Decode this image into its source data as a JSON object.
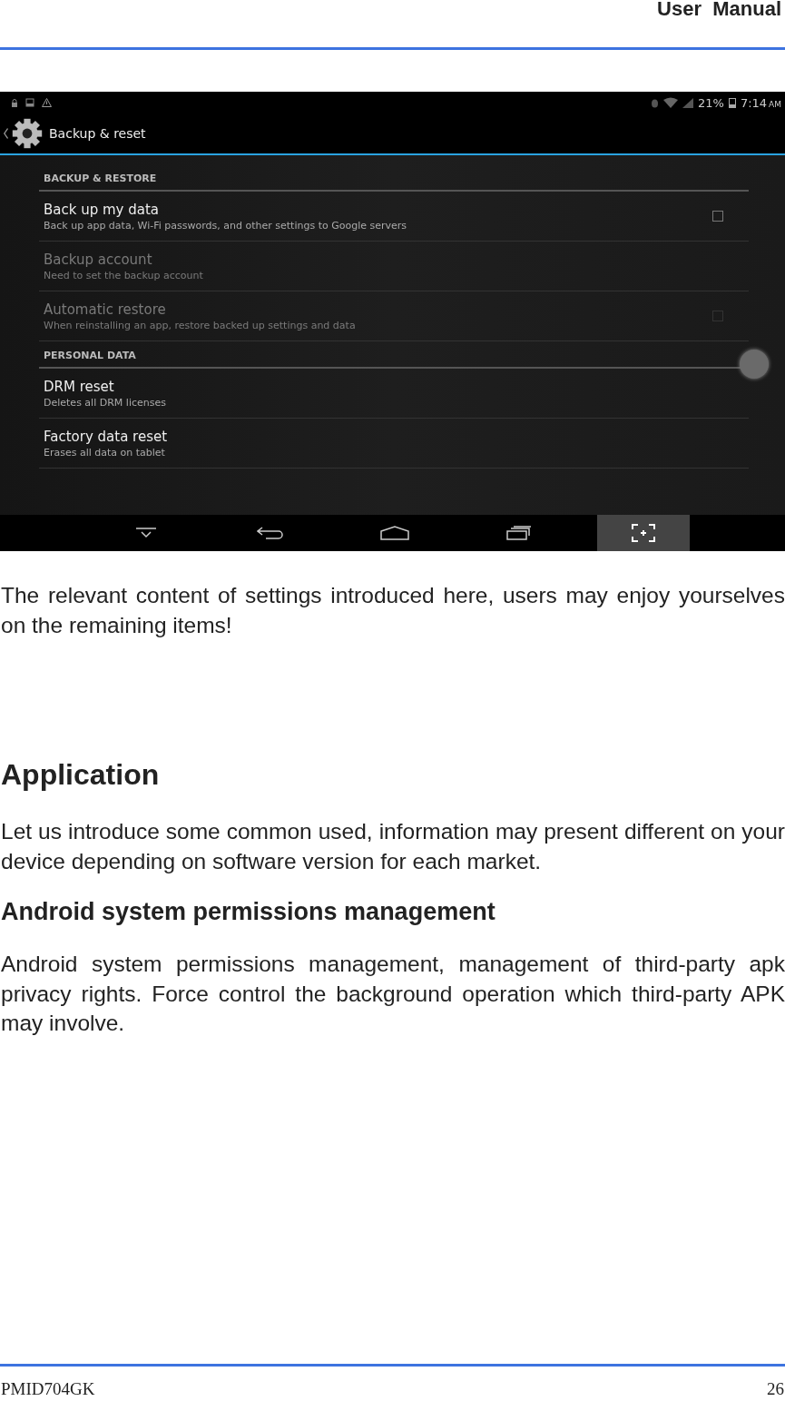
{
  "header": {
    "title": "User  Manual"
  },
  "screenshot": {
    "status_bar": {
      "battery": "21%",
      "time": "7:14",
      "meridiem": "AM"
    },
    "action_bar": {
      "title": "Backup & reset"
    },
    "sections": [
      {
        "title": "BACKUP & RESTORE",
        "items": [
          {
            "kind": "checkbox",
            "title": "Back up my data",
            "summary": "Back up app data, Wi-Fi passwords, and other settings to Google servers",
            "disabled": false,
            "checked": false
          },
          {
            "kind": "plain",
            "title": "Backup account",
            "summary": "Need to set the backup account",
            "disabled": true
          },
          {
            "kind": "checkbox",
            "title": "Automatic restore",
            "summary": "When reinstalling an app, restore backed up settings and data",
            "disabled": true,
            "checked": false
          }
        ]
      },
      {
        "title": "PERSONAL DATA",
        "items": [
          {
            "kind": "plain",
            "title": "DRM reset",
            "summary": "Deletes all DRM licenses",
            "disabled": false
          },
          {
            "kind": "plain",
            "title": "Factory data reset",
            "summary": "Erases all data on tablet",
            "disabled": false
          }
        ]
      }
    ]
  },
  "blocks": [
    {
      "kind": "paragraph",
      "text": "The relevant content of settings introduced here, users may enjoy yourselves on the remaining items!"
    },
    {
      "kind": "heading",
      "text": "Application"
    },
    {
      "kind": "paragraph",
      "text": "Let us introduce some common used, information may present different on your device depending on software version for each market."
    },
    {
      "kind": "subheading",
      "text": "Android system permissions management"
    },
    {
      "kind": "paragraph",
      "text": "Android system permissions management, management of third-party apk privacy rights. Force control the background operation which third-party APK may involve."
    }
  ],
  "footer": {
    "model": "PMID704GK",
    "page": "26"
  }
}
